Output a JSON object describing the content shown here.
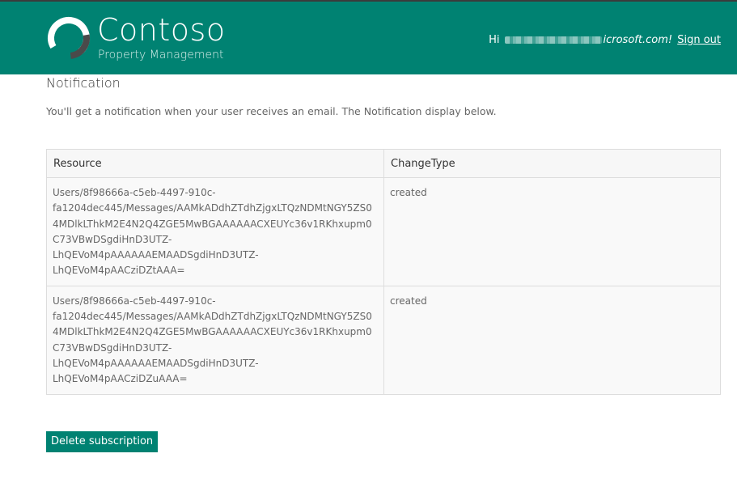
{
  "header": {
    "brand_name": "Contoso",
    "brand_subtitle": "Property Management",
    "greeting": "Hi",
    "user_email_visible": "icrosoft.com!",
    "signout_label": "Sign out",
    "logo_icon": "contoso-ring-logo-icon",
    "bg_color": "#008272"
  },
  "page": {
    "title": "Notification",
    "intro": "You'll get a notification when your user receives an email. The Notification display below."
  },
  "table": {
    "columns": [
      "Resource",
      "ChangeType"
    ],
    "rows": [
      {
        "resource_lines": [
          "Users/8f98666a-c5eb-4497-910c-",
          "fa1204dec445/Messages/AAMkADdhZTdhZjgxLTQzNDMtNGY5ZS0",
          "4MDlkLThkM2E4N2Q4ZGE5MwBGAAAAAACXEUYc36v1RKhxupm0",
          "C73VBwDSgdiHnD3UTZ-",
          "LhQEVoM4pAAAAAAEMAADSgdiHnD3UTZ-",
          "LhQEVoM4pAACziDZtAAA="
        ],
        "change_type": "created"
      },
      {
        "resource_lines": [
          "Users/8f98666a-c5eb-4497-910c-",
          "fa1204dec445/Messages/AAMkADdhZTdhZjgxLTQzNDMtNGY5ZS0",
          "4MDlkLThkM2E4N2Q4ZGE5MwBGAAAAAACXEUYc36v1RKhxupm0",
          "C73VBwDSgdiHnD3UTZ-",
          "LhQEVoM4pAAAAAAEMAADSgdiHnD3UTZ-",
          "LhQEVoM4pAACziDZuAAA="
        ],
        "change_type": "created"
      }
    ]
  },
  "actions": {
    "delete_label": "Delete subscription",
    "accent_color": "#008272"
  }
}
